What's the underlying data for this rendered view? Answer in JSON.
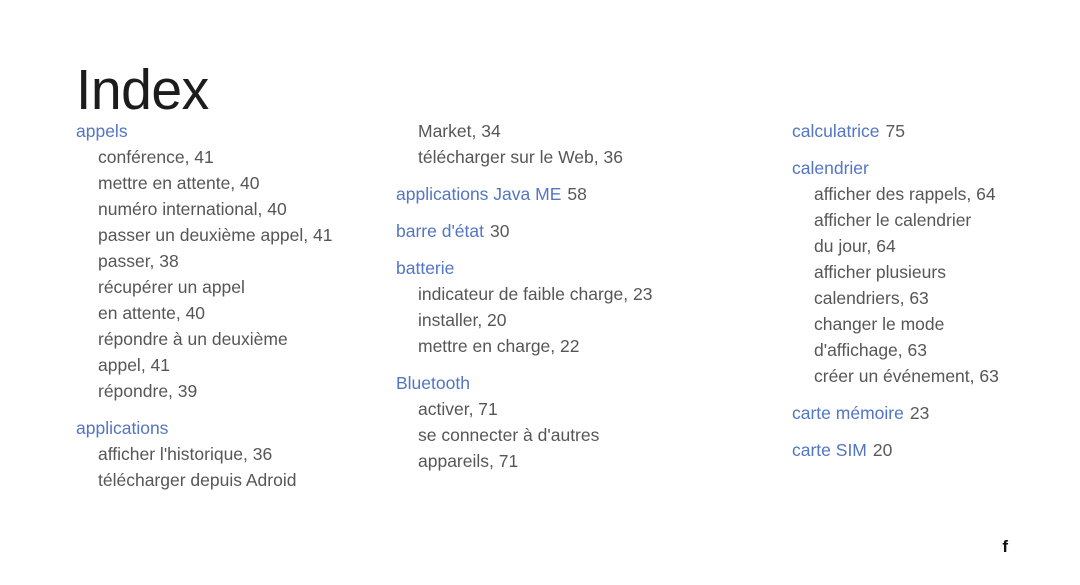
{
  "document": {
    "title": "Index",
    "footer_mark": "f",
    "colors": {
      "heading_blue": "#5275c4",
      "body_gray": "#565656",
      "title_black": "#1c1c1c"
    }
  },
  "columns": [
    {
      "groups": [
        {
          "heading": "appels",
          "heading_page": "",
          "entries": [
            "conférence,  41",
            "mettre en attente,  40",
            "numéro international,  40",
            "passer un deuxième appel,  41",
            "passer,  38",
            "récupérer un appel",
            "en attente,  40",
            "répondre à un deuxième",
            "appel,  41",
            "répondre,  39"
          ]
        },
        {
          "heading": "applications",
          "heading_page": "",
          "entries": [
            "afficher l'historique,  36",
            "télécharger depuis Adroid"
          ]
        }
      ]
    },
    {
      "groups": [
        {
          "heading": "",
          "heading_page": "",
          "entries": [
            "Market,  34",
            "télécharger sur le Web,  36"
          ]
        },
        {
          "heading": "applications Java ME",
          "heading_page": "58",
          "entries": []
        },
        {
          "heading": "barre d'état",
          "heading_page": "30",
          "entries": []
        },
        {
          "heading": "batterie",
          "heading_page": "",
          "entries": [
            "indicateur de faible charge,  23",
            "installer,  20",
            "mettre en charge,  22"
          ]
        },
        {
          "heading": "Bluetooth",
          "heading_page": "",
          "entries": [
            "activer,  71",
            "se connecter à d'autres",
            "appareils,  71"
          ]
        }
      ]
    },
    {
      "groups": [
        {
          "heading": "calculatrice",
          "heading_page": "75",
          "entries": []
        },
        {
          "heading": "calendrier",
          "heading_page": "",
          "entries": [
            "afficher des rappels,  64",
            "afficher le calendrier",
            "du jour,  64",
            "afficher plusieurs",
            "calendriers,  63",
            "changer le mode",
            "d'affichage,  63",
            "créer un événement,  63"
          ]
        },
        {
          "heading": "carte mémoire",
          "heading_page": "23",
          "entries": []
        },
        {
          "heading": "carte SIM",
          "heading_page": "20",
          "entries": []
        }
      ]
    }
  ]
}
